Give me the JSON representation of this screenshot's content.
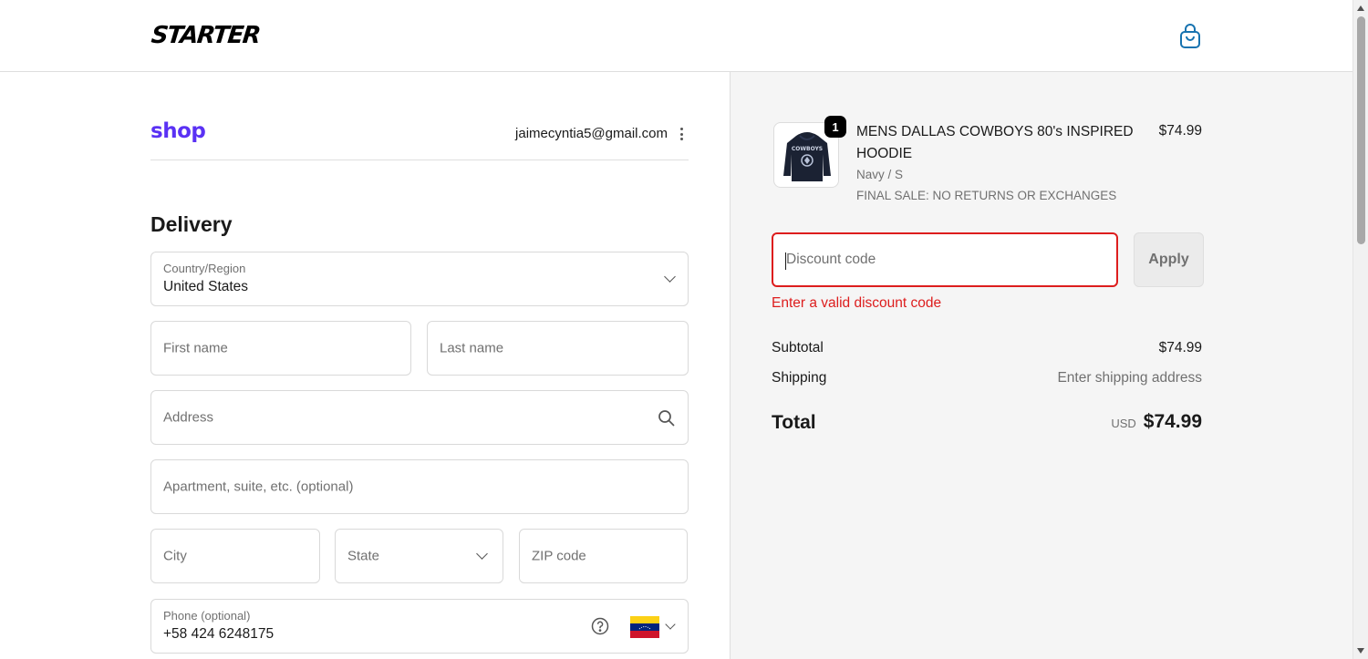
{
  "header": {
    "brand": "STARTER",
    "cart_icon": "shopping-bag-icon"
  },
  "account": {
    "shop_brand": "shop",
    "email": "jaimecyntia5@gmail.com",
    "menu_icon": "kebab-menu-icon"
  },
  "delivery": {
    "title": "Delivery",
    "country": {
      "label": "Country/Region",
      "value": "United States"
    },
    "first_name": {
      "placeholder": "First name",
      "value": ""
    },
    "last_name": {
      "placeholder": "Last name",
      "value": ""
    },
    "address": {
      "placeholder": "Address",
      "value": ""
    },
    "apartment": {
      "placeholder": "Apartment, suite, etc. (optional)",
      "value": ""
    },
    "city": {
      "placeholder": "City",
      "value": ""
    },
    "state": {
      "placeholder": "State",
      "value": ""
    },
    "zip": {
      "placeholder": "ZIP code",
      "value": ""
    },
    "phone": {
      "label": "Phone (optional)",
      "value": "+58 424 6248175",
      "help_icon": "question-circle-icon",
      "flag": "venezuela-flag"
    }
  },
  "order": {
    "item": {
      "quantity": "1",
      "title": "MENS DALLAS COWBOYS 80's INSPIRED HOODIE",
      "variant": "Navy / S",
      "note": "FINAL SALE: NO RETURNS OR EXCHANGES",
      "price": "$74.99"
    },
    "discount": {
      "placeholder": "Discount code",
      "value": "",
      "apply_label": "Apply",
      "error": "Enter a valid discount code"
    },
    "subtotal_label": "Subtotal",
    "subtotal_value": "$74.99",
    "shipping_label": "Shipping",
    "shipping_value": "Enter shipping address",
    "total_label": "Total",
    "total_currency": "USD",
    "total_value": "$74.99"
  },
  "colors": {
    "shop_purple": "#5a31f4",
    "error_red": "#dd1d1d",
    "summary_bg": "#f5f5f5",
    "cart_blue": "#1773b0"
  }
}
